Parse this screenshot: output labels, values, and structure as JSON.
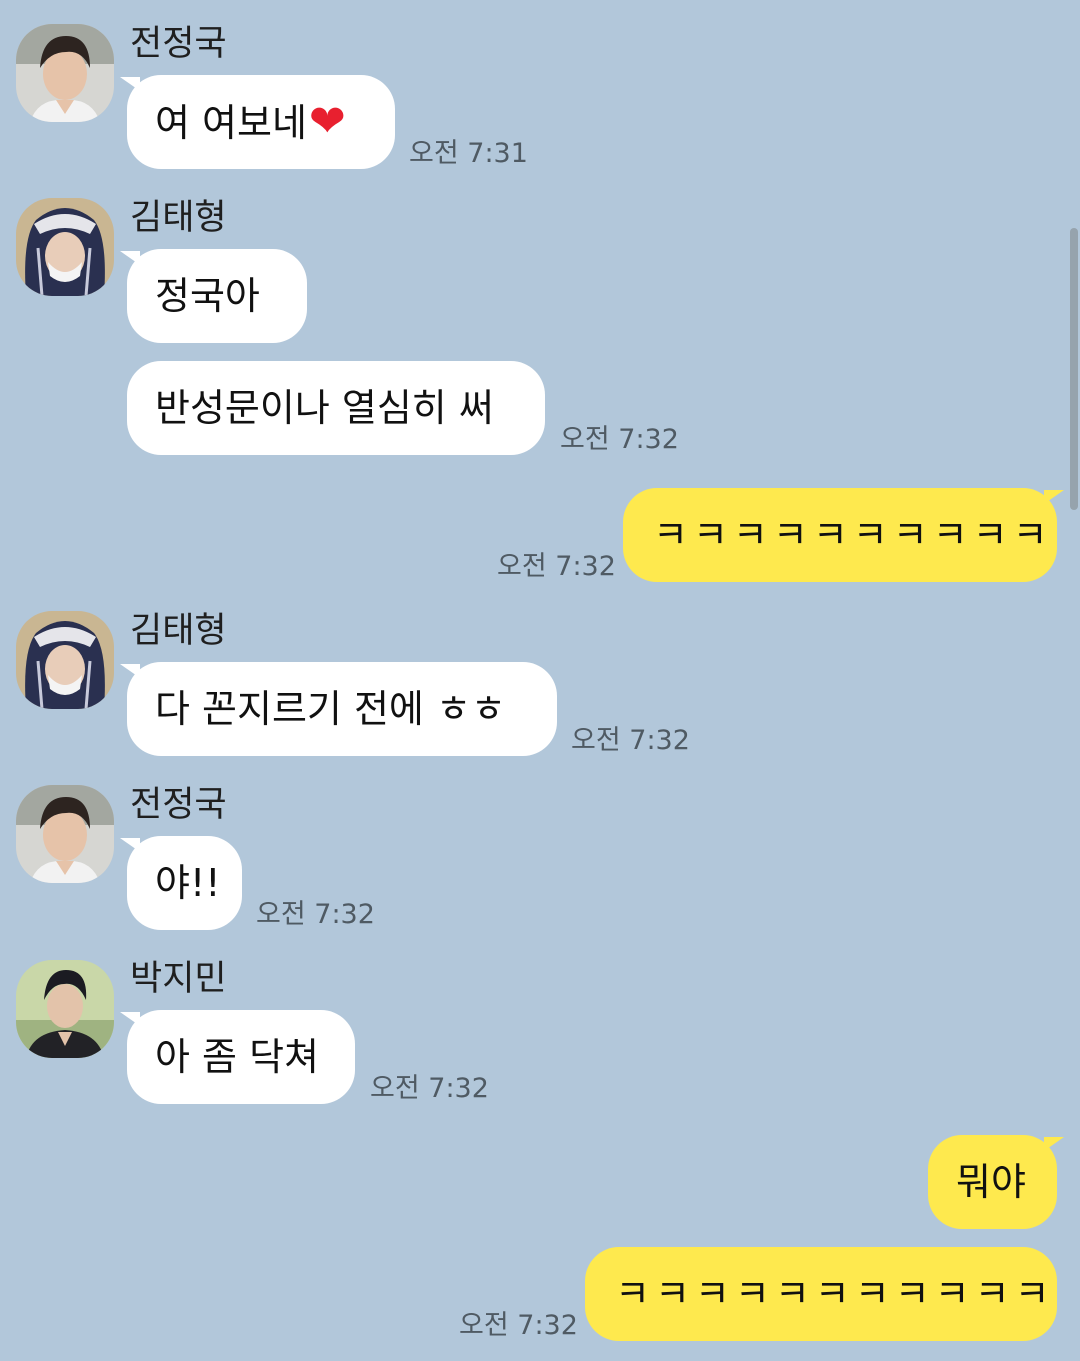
{
  "messages": [
    {
      "sender": "전정국",
      "text": "여 여보네",
      "emoji": "❤",
      "time": "오전 7:31"
    },
    {
      "sender": "김태형",
      "text": "정국아"
    },
    {
      "text": "반성문이나 열심히 써",
      "time": "오전 7:32"
    },
    {
      "text": "ㅋㅋㅋㅋㅋㅋㅋㅋㅋㅋ",
      "time": "오전 7:32"
    },
    {
      "sender": "김태형",
      "text": "다 꼰지르기 전에 ㅎㅎ",
      "time": "오전 7:32"
    },
    {
      "sender": "전정국",
      "text": "야!!",
      "time": "오전 7:32"
    },
    {
      "sender": "박지민",
      "text": "아 좀 닥쳐",
      "time": "오전 7:32"
    },
    {
      "text": "뭐야"
    },
    {
      "text": "ㅋㅋㅋㅋㅋㅋㅋㅋㅋㅋㅋ",
      "time": "오전 7:32"
    }
  ],
  "colors": {
    "background": "#b2c7da",
    "incoming_bubble": "#ffffff",
    "outgoing_bubble": "#fee94e",
    "timestamp": "#4f5a63",
    "heart": "#e8202f"
  },
  "icons": {
    "avatar_1": "profile-photo-jungkook",
    "avatar_2": "profile-photo-taehyung",
    "avatar_3": "profile-photo-jimin",
    "heart": "red-heart-emoji"
  }
}
